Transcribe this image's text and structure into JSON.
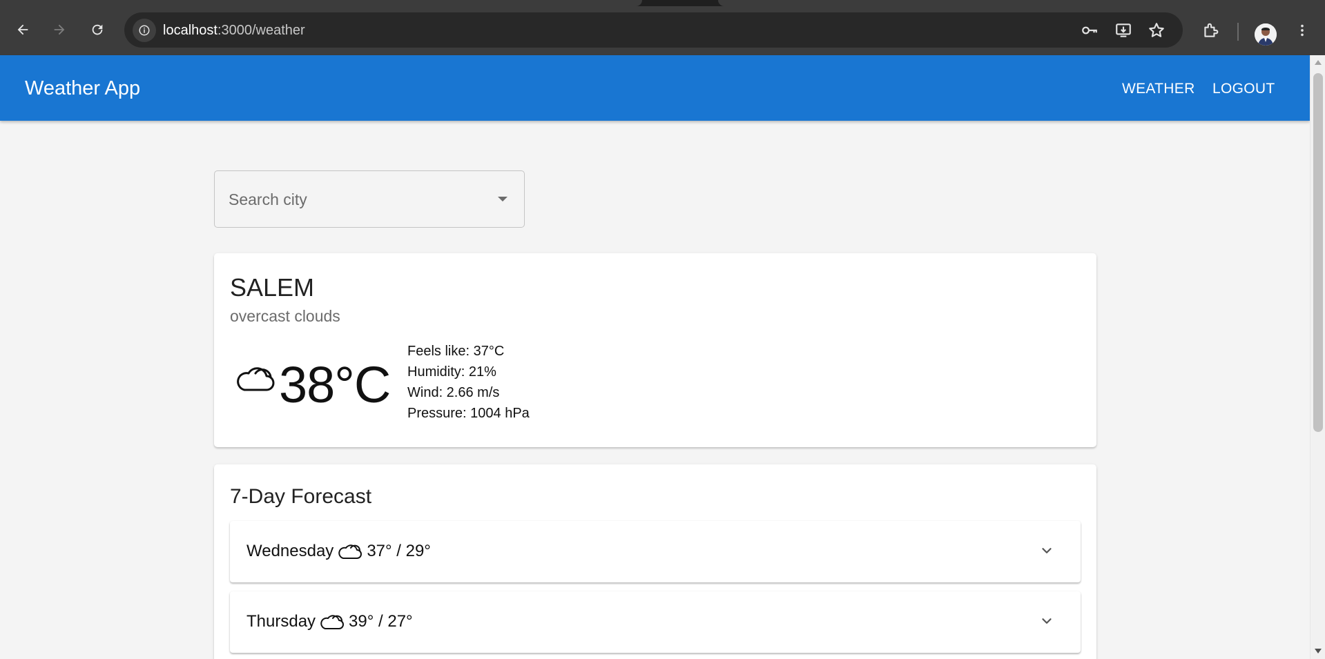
{
  "browser": {
    "url_host": "localhost",
    "url_path": ":3000/weather"
  },
  "app": {
    "title": "Weather App",
    "nav": [
      "WEATHER",
      "LOGOUT"
    ]
  },
  "search": {
    "placeholder": "Search city"
  },
  "current": {
    "city": "SALEM",
    "description": "overcast clouds",
    "temperature": "38°C",
    "feels_like": "Feels like: 37°C",
    "humidity": "Humidity: 21%",
    "wind": "Wind: 2.66 m/s",
    "pressure": "Pressure: 1004 hPa",
    "icon": "cloud-icon"
  },
  "forecast": {
    "title": "7-Day Forecast",
    "days": [
      {
        "day": "Wednesday",
        "icon": "cloud-icon",
        "temps": "37° / 29°"
      },
      {
        "day": "Thursday",
        "icon": "cloud-icon",
        "temps": "39° / 27°"
      }
    ]
  },
  "colors": {
    "appbar": "#1976d2",
    "background": "#f4f4f4",
    "browser_chrome": "#3c3c3c"
  }
}
